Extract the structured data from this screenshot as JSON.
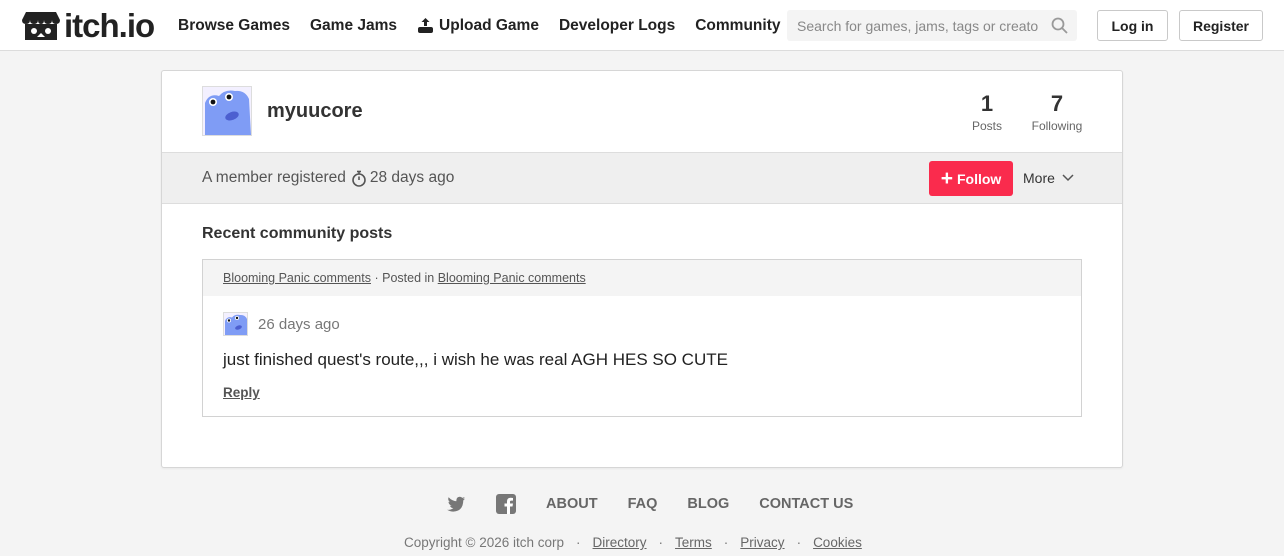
{
  "header": {
    "logo_text": "itch.io",
    "nav": [
      {
        "label": "Browse Games"
      },
      {
        "label": "Game Jams"
      },
      {
        "label": "Upload Game",
        "icon": "upload-controller-icon"
      },
      {
        "label": "Developer Logs"
      },
      {
        "label": "Community"
      }
    ],
    "search": {
      "placeholder": "Search for games, jams, tags or creators",
      "value": ""
    },
    "login_label": "Log in",
    "register_label": "Register"
  },
  "profile": {
    "username": "myuucore",
    "stats": [
      {
        "value": "1",
        "label": "Posts"
      },
      {
        "value": "7",
        "label": "Following"
      }
    ],
    "member_prefix": "A member registered",
    "member_age": "28 days ago",
    "follow_label": "Follow",
    "more_label": "More"
  },
  "recent": {
    "title": "Recent community posts",
    "posts": [
      {
        "topic_link": "Blooming Panic comments",
        "separator": "· Posted in",
        "board_link": "Blooming Panic comments",
        "date": "26 days ago",
        "body": "just finished quest's route,,, i wish he was real AGH HES SO CUTE",
        "reply_label": "Reply"
      }
    ]
  },
  "footer": {
    "social_icons": [
      "twitter-icon",
      "facebook-icon"
    ],
    "links": [
      "ABOUT",
      "FAQ",
      "BLOG",
      "CONTACT US"
    ],
    "copyright": "Copyright © 2026 itch corp",
    "legal_links": [
      "Directory",
      "Terms",
      "Privacy",
      "Cookies"
    ]
  },
  "colors": {
    "accent": "#fa2b4d",
    "background": "#f4f4f4"
  }
}
